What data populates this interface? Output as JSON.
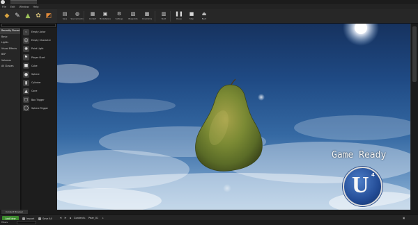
{
  "menu": [
    "File",
    "Edit",
    "Window",
    "Help"
  ],
  "categories": [
    "Recently Placed",
    "Basic",
    "Lights",
    "Visual Effects",
    "BSP",
    "Volumes",
    "All Classes"
  ],
  "active_category": "Recently Placed",
  "place_items": [
    {
      "label": "Empty Actor",
      "icon": "empty-actor-icon",
      "glyph": "◦"
    },
    {
      "label": "Empty Character",
      "icon": "character-icon",
      "glyph": "☺"
    },
    {
      "label": "Point Light",
      "icon": "point-light-icon",
      "glyph": "✺"
    },
    {
      "label": "Player Start",
      "icon": "player-start-icon",
      "glyph": "⚑"
    },
    {
      "label": "Cube",
      "icon": "cube-icon",
      "glyph": "■"
    },
    {
      "label": "Sphere",
      "icon": "sphere-icon",
      "glyph": "●"
    },
    {
      "label": "Cylinder",
      "icon": "cylinder-icon",
      "glyph": "▮"
    },
    {
      "label": "Cone",
      "icon": "cone-icon",
      "glyph": "▲"
    },
    {
      "label": "Box Trigger",
      "icon": "box-trigger-icon",
      "glyph": "▢"
    },
    {
      "label": "Sphere Trigger",
      "icon": "sphere-trigger-icon",
      "glyph": "◯"
    }
  ],
  "toolbar": [
    {
      "label": "Save",
      "icon": "save-icon",
      "glyph": "▤"
    },
    {
      "label": "Source Control",
      "icon": "source-control-icon",
      "glyph": "◍"
    },
    {
      "label": "Content",
      "icon": "content-icon",
      "glyph": "▦"
    },
    {
      "label": "Marketplace",
      "icon": "marketplace-icon",
      "glyph": "▣"
    },
    {
      "label": "Settings",
      "icon": "settings-icon",
      "glyph": "⚙"
    },
    {
      "label": "Blueprints",
      "icon": "blueprints-icon",
      "glyph": "▧"
    },
    {
      "label": "Cinematics",
      "icon": "cinematics-icon",
      "glyph": "▩"
    },
    {
      "label": "Build",
      "icon": "build-icon",
      "glyph": "▥"
    },
    {
      "label": "Pause",
      "icon": "pause-icon",
      "glyph": "❚❚"
    },
    {
      "label": "Stop",
      "icon": "stop-icon",
      "glyph": "■"
    },
    {
      "label": "Eject",
      "icon": "eject-icon",
      "glyph": "⏏"
    }
  ],
  "viewport": {
    "overlay_text": "Game Ready",
    "badge_glyph": "U",
    "badge_version": "4"
  },
  "content_browser": {
    "tab_label": "Content Browser",
    "add_new": "Add New",
    "import": "Import",
    "save_all": "Save All",
    "path": [
      "Content",
      "Pear_01"
    ],
    "filters": "Filters"
  },
  "colors": {
    "sky_top": "#16325f",
    "sky_bottom": "#93b7d8",
    "pear_green": "#6b8a2e",
    "add_new_green": "#3d8a2e"
  }
}
